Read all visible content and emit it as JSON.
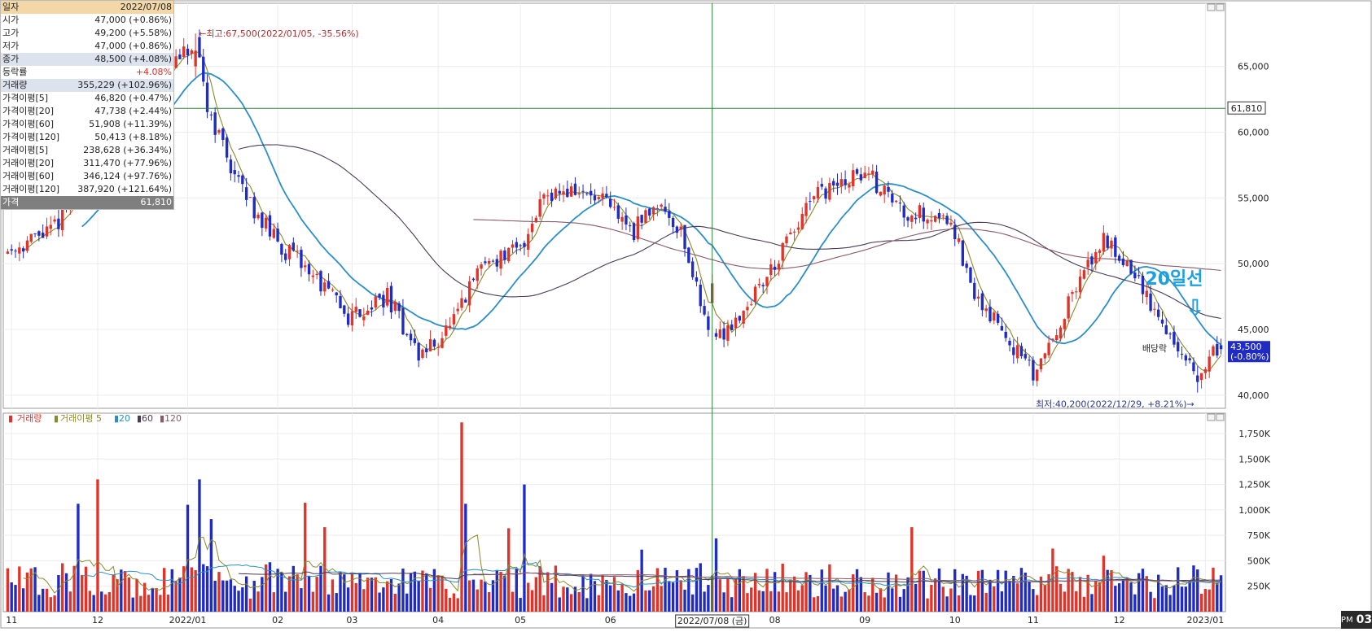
{
  "info_panel": {
    "rows": [
      {
        "label": "일자",
        "value": "2022/07/08",
        "style": "head"
      },
      {
        "label": "시가",
        "value": "47,000 (+0.86%)"
      },
      {
        "label": "고가",
        "value": "49,200 (+5.58%)"
      },
      {
        "label": "저가",
        "value": "47,000 (+0.86%)"
      },
      {
        "label": "종가",
        "value": "48,500 (+4.08%)",
        "style": "hl"
      },
      {
        "label": "등락률",
        "value": "+4.08%",
        "value_color": "#e0342b"
      },
      {
        "label": "거래량",
        "value": "355,229 (+102.96%)",
        "style": "hl"
      },
      {
        "label": "가격이평[5]",
        "value": "46,820 (+0.47%)"
      },
      {
        "label": "가격이평[20]",
        "value": "47,738 (+2.44%)"
      },
      {
        "label": "가격이평[60]",
        "value": "51,908 (+11.39%)"
      },
      {
        "label": "가격이평[120]",
        "value": "50,413 (+8.18%)"
      },
      {
        "label": "거래이평[5]",
        "value": "238,628 (+36.34%)"
      },
      {
        "label": "거래이평[20]",
        "value": "311,470 (+77.96%)"
      },
      {
        "label": "거래이평[60]",
        "value": "346,124 (+97.76%)"
      },
      {
        "label": "거래이평[120]",
        "value": "387,920 (+121.64%)"
      },
      {
        "label": "가격",
        "value": "61,810",
        "style": "last"
      }
    ]
  },
  "time_badge": {
    "ampm": "PM",
    "hour": "03"
  },
  "colors": {
    "up": "#e0342b",
    "down": "#1f2bc2",
    "ma5": "#8a8a2a",
    "ma20": "#2b8fc7",
    "ma60": "#4a3a55",
    "ma120": "#8a5a6a",
    "crosshair": "#2f7f3a",
    "annot_blue": "#1ea0e0"
  },
  "chart_data": {
    "type": "candlestick",
    "x_tick_labels": [
      {
        "label": "11",
        "date": "2021-11-01"
      },
      {
        "label": "12",
        "date": "2021-12-01"
      },
      {
        "label": "2022/01",
        "date": "2022-01-03"
      },
      {
        "label": "02",
        "date": "2022-02-03"
      },
      {
        "label": "03",
        "date": "2022-03-02"
      },
      {
        "label": "04",
        "date": "2022-04-01"
      },
      {
        "label": "05",
        "date": "2022-05-02"
      },
      {
        "label": "06",
        "date": "2022-06-02"
      },
      {
        "label": "08",
        "date": "2022-08-01"
      },
      {
        "label": "09",
        "date": "2022-09-01"
      },
      {
        "label": "10",
        "date": "2022-10-04"
      },
      {
        "label": "11",
        "date": "2022-11-01"
      },
      {
        "label": "12",
        "date": "2022-12-01"
      },
      {
        "label": "2023/01",
        "date": "2023-01-02"
      }
    ],
    "x_range": [
      "2021-10-29",
      "2023-01-06"
    ],
    "crosshair": {
      "date": "2022-07-08",
      "date_label": "2022/07/08 (금)",
      "price": 61810,
      "price_label": "61,810"
    },
    "price_axis": {
      "ylim": [
        39000,
        69800
      ],
      "ticks": [
        40000,
        45000,
        50000,
        55000,
        60000,
        65000
      ],
      "tick_labels": [
        "40,000",
        "45,000",
        "50,000",
        "55,000",
        "60,000",
        "65,000"
      ]
    },
    "volume_axis": {
      "ylim": [
        0,
        1950000
      ],
      "ticks": [
        250000,
        500000,
        750000,
        1000000,
        1250000,
        1500000,
        1750000
      ],
      "tick_labels": [
        "250K",
        "500K",
        "750K",
        "1,000K",
        "1,250K",
        "1,500K",
        "1,750K"
      ]
    },
    "volume_legend": {
      "volume": "거래량",
      "vol_ma": "거래이평",
      "periods": [
        "5",
        "20",
        "60",
        "120"
      ]
    },
    "annotations": {
      "high": {
        "text": "←최고:67,500(2022/01/05, -35.56%)",
        "date": "2022-01-05",
        "price": 67500
      },
      "low": {
        "text": "최저:40,200(2022/12/29, +8.21%)→",
        "date": "2022-12-29",
        "price": 40200
      },
      "ma20_callout": "20일선",
      "ex_dividend": "배당락",
      "last_price": {
        "price_label": "43,500",
        "change_label": "(-0.80%)",
        "price": 43500
      }
    },
    "price_anchors": [
      [
        "2021-10-29",
        51000
      ],
      [
        "2021-11-15",
        52500
      ],
      [
        "2021-12-01",
        57500
      ],
      [
        "2021-12-15",
        63000
      ],
      [
        "2022-01-05",
        66500
      ],
      [
        "2022-01-10",
        62000
      ],
      [
        "2022-01-20",
        56000
      ],
      [
        "2022-02-03",
        51500
      ],
      [
        "2022-02-15",
        49500
      ],
      [
        "2022-03-01",
        46000
      ],
      [
        "2022-03-15",
        47500
      ],
      [
        "2022-03-25",
        43000
      ],
      [
        "2022-04-01",
        44200
      ],
      [
        "2022-04-08",
        46000
      ],
      [
        "2022-04-18",
        50000
      ],
      [
        "2022-05-02",
        51000
      ],
      [
        "2022-05-10",
        55500
      ],
      [
        "2022-05-20",
        55500
      ],
      [
        "2022-06-01",
        54500
      ],
      [
        "2022-06-10",
        52500
      ],
      [
        "2022-06-20",
        54800
      ],
      [
        "2022-06-28",
        52500
      ],
      [
        "2022-07-05",
        47000
      ],
      [
        "2022-07-11",
        44200
      ],
      [
        "2022-07-20",
        46500
      ],
      [
        "2022-08-01",
        50000
      ],
      [
        "2022-08-15",
        55000
      ],
      [
        "2022-09-01",
        57000
      ],
      [
        "2022-09-15",
        54000
      ],
      [
        "2022-10-01",
        53500
      ],
      [
        "2022-10-10",
        48000
      ],
      [
        "2022-10-20",
        45000
      ],
      [
        "2022-11-01",
        41500
      ],
      [
        "2022-11-15",
        47500
      ],
      [
        "2022-11-25",
        52000
      ],
      [
        "2022-12-05",
        50000
      ],
      [
        "2022-12-15",
        46000
      ],
      [
        "2022-12-20",
        44500
      ],
      [
        "2022-12-29",
        41000
      ],
      [
        "2023-01-03",
        43000
      ],
      [
        "2023-01-06",
        43500
      ]
    ],
    "volume_spikes": [
      [
        "2021-11-24",
        1060000
      ],
      [
        "2021-12-01",
        1300000
      ],
      [
        "2022-01-03",
        1050000
      ],
      [
        "2022-01-06",
        1300000
      ],
      [
        "2022-01-11",
        910000
      ],
      [
        "2022-02-14",
        1070000
      ],
      [
        "2022-02-21",
        830000
      ],
      [
        "2022-04-11",
        1860000
      ],
      [
        "2022-04-12",
        1060000
      ],
      [
        "2022-04-27",
        820000
      ],
      [
        "2022-05-03",
        1250000
      ],
      [
        "2022-07-08",
        355229
      ],
      [
        "2022-06-14",
        610000
      ],
      [
        "2022-07-11",
        720000
      ],
      [
        "2022-09-19",
        830000
      ],
      [
        "2022-11-08",
        620000
      ],
      [
        "2022-11-25",
        550000
      ]
    ],
    "series": [
      {
        "name": "5",
        "kind": "price_ma",
        "period": 5
      },
      {
        "name": "20",
        "kind": "price_ma",
        "period": 20
      },
      {
        "name": "60",
        "kind": "price_ma",
        "period": 60
      },
      {
        "name": "120",
        "kind": "price_ma",
        "period": 120
      }
    ]
  }
}
